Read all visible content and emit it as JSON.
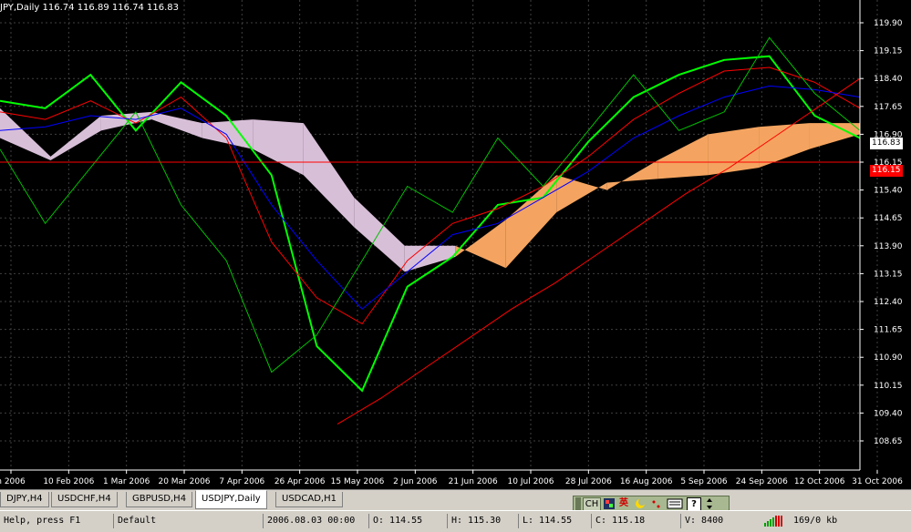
{
  "chart_title": "JPY,Daily  116.74 116.89 116.74 116.83",
  "price_axis": {
    "labels": [
      "119.90",
      "119.15",
      "118.40",
      "117.65",
      "116.90",
      "116.15",
      "115.40",
      "114.65",
      "113.90",
      "113.15",
      "112.40",
      "111.65",
      "110.90",
      "110.15",
      "109.40",
      "108.65"
    ],
    "current_price": "116.83",
    "line_price": "116.15"
  },
  "time_axis": {
    "labels": [
      "n 2006",
      "10 Feb 2006",
      "1 Mar 2006",
      "20 Mar 2006",
      "7 Apr 2006",
      "26 Apr 2006",
      "15 May 2006",
      "2 Jun 2006",
      "21 Jun 2006",
      "10 Jul 2006",
      "28 Jul 2006",
      "16 Aug 2006",
      "5 Sep 2006",
      "24 Sep 2006",
      "12 Oct 2006",
      "31 Oct 2006"
    ]
  },
  "tabs": [
    {
      "label": "DJPY,H4",
      "active": false
    },
    {
      "label": "USDCHF,H4",
      "active": false
    },
    {
      "label": "GBPUSD,H4",
      "active": false
    },
    {
      "label": "USDJPY,Daily",
      "active": true
    },
    {
      "label": "USDCAD,H1",
      "active": false
    }
  ],
  "ime_bar": {
    "items": [
      "CH",
      "英",
      "?"
    ],
    "icons": [
      "ime-logo-icon",
      "moon-icon",
      "dot-icon",
      "keyboard-icon",
      "help-icon",
      "arrow-icon"
    ]
  },
  "status_bar": {
    "help": "Help, press F1",
    "profile": "Default",
    "datetime": "2006.08.03 00:00",
    "open": "O: 114.55",
    "high": "H: 115.30",
    "low": "L: 114.55",
    "close": "C: 115.18",
    "volume": "V: 8400",
    "traffic": "169/0 kb"
  },
  "chart_data": {
    "type": "line",
    "title": "",
    "xlabel": "",
    "ylabel": "",
    "ylim": [
      108.65,
      119.9
    ],
    "x": [
      "2006-01-22",
      "2006-02-10",
      "2006-03-01",
      "2006-03-20",
      "2006-04-07",
      "2006-04-26",
      "2006-05-15",
      "2006-06-02",
      "2006-06-21",
      "2006-07-10",
      "2006-07-28",
      "2006-08-16",
      "2006-09-05",
      "2006-09-24",
      "2006-10-12",
      "2006-10-31"
    ],
    "series": [
      {
        "values": [
          117.8,
          117.6,
          118.5,
          117.0,
          118.3,
          117.4,
          115.8,
          111.2,
          110.0,
          112.8,
          113.6,
          115.0,
          115.2,
          116.7,
          117.9,
          118.5,
          118.9,
          119.0,
          117.4,
          116.8
        ]
      },
      {
        "values": [
          117.5,
          117.3,
          117.8,
          117.2,
          117.9,
          116.8,
          114.0,
          112.5,
          111.8,
          113.5,
          114.5,
          114.9,
          115.5,
          116.3,
          117.3,
          118.0,
          118.6,
          118.7,
          118.3,
          117.6
        ]
      },
      {
        "values": [
          117.0,
          117.1,
          117.4,
          117.3,
          117.6,
          116.9,
          115.0,
          113.5,
          112.2,
          113.2,
          114.2,
          114.5,
          115.2,
          115.9,
          116.8,
          117.4,
          117.9,
          118.2,
          118.1,
          117.9
        ]
      },
      {
        "values": [
          116.5,
          114.5,
          116.0,
          117.5,
          115.0,
          113.5,
          110.5,
          111.5,
          113.5,
          115.5,
          114.8,
          116.8,
          115.5,
          117.0,
          118.5,
          117.0,
          117.5,
          119.5,
          118.0,
          117.0
        ]
      },
      {
        "values": [
          109.1,
          109.8,
          110.6,
          111.4,
          112.2,
          112.9,
          113.7,
          114.5,
          115.3,
          116.0,
          116.8,
          117.6,
          118.4
        ]
      },
      {
        "values": [
          116.15,
          116.15
        ]
      }
    ],
    "cloud": {
      "span_a": [
        116.8,
        116.2,
        117.0,
        117.3,
        116.8,
        116.5,
        115.8,
        114.4,
        113.2,
        113.6,
        114.6,
        115.8,
        115.4,
        116.2,
        116.9,
        117.1,
        117.2,
        117.2
      ],
      "span_b": [
        117.6,
        116.3,
        117.4,
        117.5,
        117.2,
        117.3,
        117.2,
        115.2,
        113.9,
        113.9,
        113.3,
        114.8,
        115.6,
        115.7,
        115.8,
        116.0,
        116.5,
        116.9
      ]
    }
  },
  "colors": {
    "background": "#000000",
    "grid": "#404040",
    "candles": "#00ff00",
    "tenkan": "#ff0000",
    "kijun": "#0000ff",
    "chikou": "#00c000",
    "trendline": "#ff0000",
    "cloud_bull": "#f4a460",
    "cloud_bear": "#d8bfd8"
  }
}
